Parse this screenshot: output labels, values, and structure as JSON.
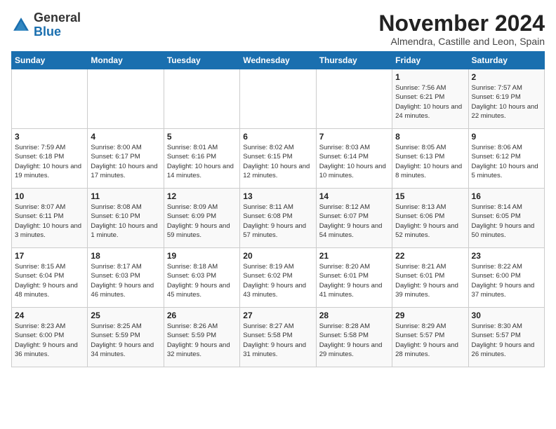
{
  "logo": {
    "general": "General",
    "blue": "Blue"
  },
  "title": "November 2024",
  "subtitle": "Almendra, Castille and Leon, Spain",
  "days_header": [
    "Sunday",
    "Monday",
    "Tuesday",
    "Wednesday",
    "Thursday",
    "Friday",
    "Saturday"
  ],
  "weeks": [
    [
      {
        "day": "",
        "info": ""
      },
      {
        "day": "",
        "info": ""
      },
      {
        "day": "",
        "info": ""
      },
      {
        "day": "",
        "info": ""
      },
      {
        "day": "",
        "info": ""
      },
      {
        "day": "1",
        "info": "Sunrise: 7:56 AM\nSunset: 6:21 PM\nDaylight: 10 hours and 24 minutes."
      },
      {
        "day": "2",
        "info": "Sunrise: 7:57 AM\nSunset: 6:19 PM\nDaylight: 10 hours and 22 minutes."
      }
    ],
    [
      {
        "day": "3",
        "info": "Sunrise: 7:59 AM\nSunset: 6:18 PM\nDaylight: 10 hours and 19 minutes."
      },
      {
        "day": "4",
        "info": "Sunrise: 8:00 AM\nSunset: 6:17 PM\nDaylight: 10 hours and 17 minutes."
      },
      {
        "day": "5",
        "info": "Sunrise: 8:01 AM\nSunset: 6:16 PM\nDaylight: 10 hours and 14 minutes."
      },
      {
        "day": "6",
        "info": "Sunrise: 8:02 AM\nSunset: 6:15 PM\nDaylight: 10 hours and 12 minutes."
      },
      {
        "day": "7",
        "info": "Sunrise: 8:03 AM\nSunset: 6:14 PM\nDaylight: 10 hours and 10 minutes."
      },
      {
        "day": "8",
        "info": "Sunrise: 8:05 AM\nSunset: 6:13 PM\nDaylight: 10 hours and 8 minutes."
      },
      {
        "day": "9",
        "info": "Sunrise: 8:06 AM\nSunset: 6:12 PM\nDaylight: 10 hours and 5 minutes."
      }
    ],
    [
      {
        "day": "10",
        "info": "Sunrise: 8:07 AM\nSunset: 6:11 PM\nDaylight: 10 hours and 3 minutes."
      },
      {
        "day": "11",
        "info": "Sunrise: 8:08 AM\nSunset: 6:10 PM\nDaylight: 10 hours and 1 minute."
      },
      {
        "day": "12",
        "info": "Sunrise: 8:09 AM\nSunset: 6:09 PM\nDaylight: 9 hours and 59 minutes."
      },
      {
        "day": "13",
        "info": "Sunrise: 8:11 AM\nSunset: 6:08 PM\nDaylight: 9 hours and 57 minutes."
      },
      {
        "day": "14",
        "info": "Sunrise: 8:12 AM\nSunset: 6:07 PM\nDaylight: 9 hours and 54 minutes."
      },
      {
        "day": "15",
        "info": "Sunrise: 8:13 AM\nSunset: 6:06 PM\nDaylight: 9 hours and 52 minutes."
      },
      {
        "day": "16",
        "info": "Sunrise: 8:14 AM\nSunset: 6:05 PM\nDaylight: 9 hours and 50 minutes."
      }
    ],
    [
      {
        "day": "17",
        "info": "Sunrise: 8:15 AM\nSunset: 6:04 PM\nDaylight: 9 hours and 48 minutes."
      },
      {
        "day": "18",
        "info": "Sunrise: 8:17 AM\nSunset: 6:03 PM\nDaylight: 9 hours and 46 minutes."
      },
      {
        "day": "19",
        "info": "Sunrise: 8:18 AM\nSunset: 6:03 PM\nDaylight: 9 hours and 45 minutes."
      },
      {
        "day": "20",
        "info": "Sunrise: 8:19 AM\nSunset: 6:02 PM\nDaylight: 9 hours and 43 minutes."
      },
      {
        "day": "21",
        "info": "Sunrise: 8:20 AM\nSunset: 6:01 PM\nDaylight: 9 hours and 41 minutes."
      },
      {
        "day": "22",
        "info": "Sunrise: 8:21 AM\nSunset: 6:01 PM\nDaylight: 9 hours and 39 minutes."
      },
      {
        "day": "23",
        "info": "Sunrise: 8:22 AM\nSunset: 6:00 PM\nDaylight: 9 hours and 37 minutes."
      }
    ],
    [
      {
        "day": "24",
        "info": "Sunrise: 8:23 AM\nSunset: 6:00 PM\nDaylight: 9 hours and 36 minutes."
      },
      {
        "day": "25",
        "info": "Sunrise: 8:25 AM\nSunset: 5:59 PM\nDaylight: 9 hours and 34 minutes."
      },
      {
        "day": "26",
        "info": "Sunrise: 8:26 AM\nSunset: 5:59 PM\nDaylight: 9 hours and 32 minutes."
      },
      {
        "day": "27",
        "info": "Sunrise: 8:27 AM\nSunset: 5:58 PM\nDaylight: 9 hours and 31 minutes."
      },
      {
        "day": "28",
        "info": "Sunrise: 8:28 AM\nSunset: 5:58 PM\nDaylight: 9 hours and 29 minutes."
      },
      {
        "day": "29",
        "info": "Sunrise: 8:29 AM\nSunset: 5:57 PM\nDaylight: 9 hours and 28 minutes."
      },
      {
        "day": "30",
        "info": "Sunrise: 8:30 AM\nSunset: 5:57 PM\nDaylight: 9 hours and 26 minutes."
      }
    ]
  ]
}
